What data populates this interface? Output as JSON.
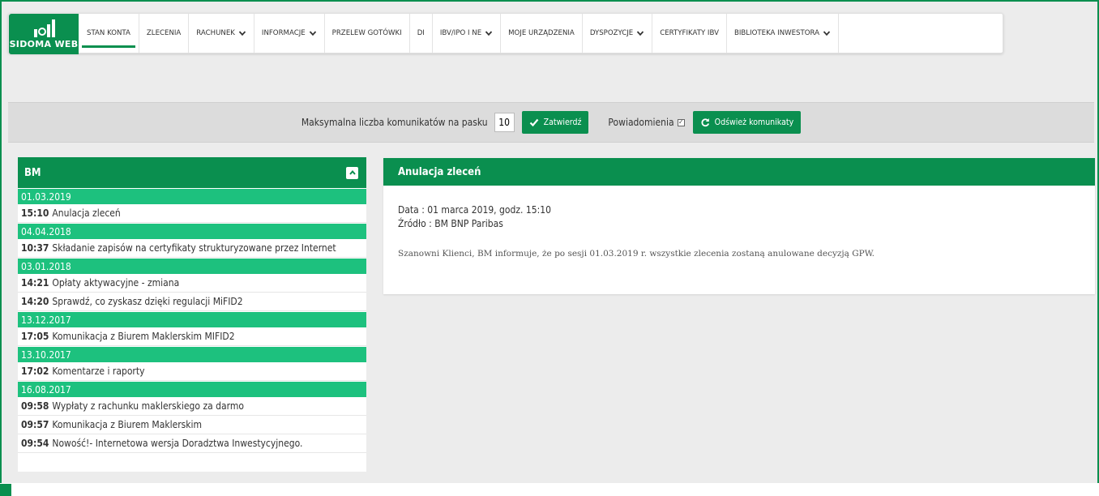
{
  "nav": {
    "logo_text": "SIDOMA WEB",
    "items": [
      {
        "label": "STAN KONTA",
        "dropdown": false,
        "active": true
      },
      {
        "label": "ZLECENIA",
        "dropdown": false
      },
      {
        "label": "RACHUNEK",
        "dropdown": true
      },
      {
        "label": "INFORMACJE",
        "dropdown": true
      },
      {
        "label": "PRZELEW GOTÓWKI",
        "dropdown": false
      },
      {
        "label": "DI",
        "dropdown": false
      },
      {
        "label": "IBV/IPO I NE",
        "dropdown": true
      },
      {
        "label": "MOJE URZĄDZENIA",
        "dropdown": false
      },
      {
        "label": "DYSPOZYCJE",
        "dropdown": true
      },
      {
        "label": "CERTYFIKATY IBV",
        "dropdown": false
      },
      {
        "label": "BIBLIOTEKA INWESTORA",
        "dropdown": true
      }
    ]
  },
  "settings": {
    "max_label": "Maksymalna liczba komunikatów na pasku",
    "max_value": "10",
    "confirm_label": "Zatwierdź",
    "notifications_label": "Powiadomienia",
    "notifications_checked": true,
    "refresh_label": "Odśwież komunikaty"
  },
  "left_panel": {
    "title": "BM",
    "groups": [
      {
        "date": "01.03.2019",
        "messages": [
          {
            "time": "15:10",
            "text": "Anulacja zleceń"
          }
        ]
      },
      {
        "date": "04.04.2018",
        "messages": [
          {
            "time": "10:37",
            "text": "Składanie zapisów na certyfikaty strukturyzowane przez Internet"
          }
        ]
      },
      {
        "date": "03.01.2018",
        "messages": [
          {
            "time": "14:21",
            "text": "Opłaty aktywacyjne - zmiana"
          },
          {
            "time": "14:20",
            "text": "Sprawdź, co zyskasz dzięki regulacji MiFID2"
          }
        ]
      },
      {
        "date": "13.12.2017",
        "messages": [
          {
            "time": "17:05",
            "text": "Komunikacja z Biurem Maklerskim MIFID2"
          }
        ]
      },
      {
        "date": "13.10.2017",
        "messages": [
          {
            "time": "17:02",
            "text": "Komentarze i raporty"
          }
        ]
      },
      {
        "date": "16.08.2017",
        "messages": [
          {
            "time": "09:58",
            "text": "Wypłaty z rachunku maklerskiego za darmo"
          },
          {
            "time": "09:57",
            "text": "Komunikacja z Biurem Maklerskim"
          },
          {
            "time": "09:54",
            "text": "Nowość!- Internetowa wersja Doradztwa Inwestycyjnego."
          }
        ]
      }
    ]
  },
  "detail": {
    "title": "Anulacja zleceń",
    "date_line": "Data : 01 marca 2019, godz. 15:10",
    "source_line": "Źródło : BM BNP Paribas",
    "body": "Szanowni Klienci, BM informuje, że po sesji 01.03.2019 r. wszystkie zlecenia zostaną anulowane decyzją GPW."
  },
  "colors": {
    "brand_green": "#0a8f4f",
    "date_green": "#1dc17e"
  }
}
